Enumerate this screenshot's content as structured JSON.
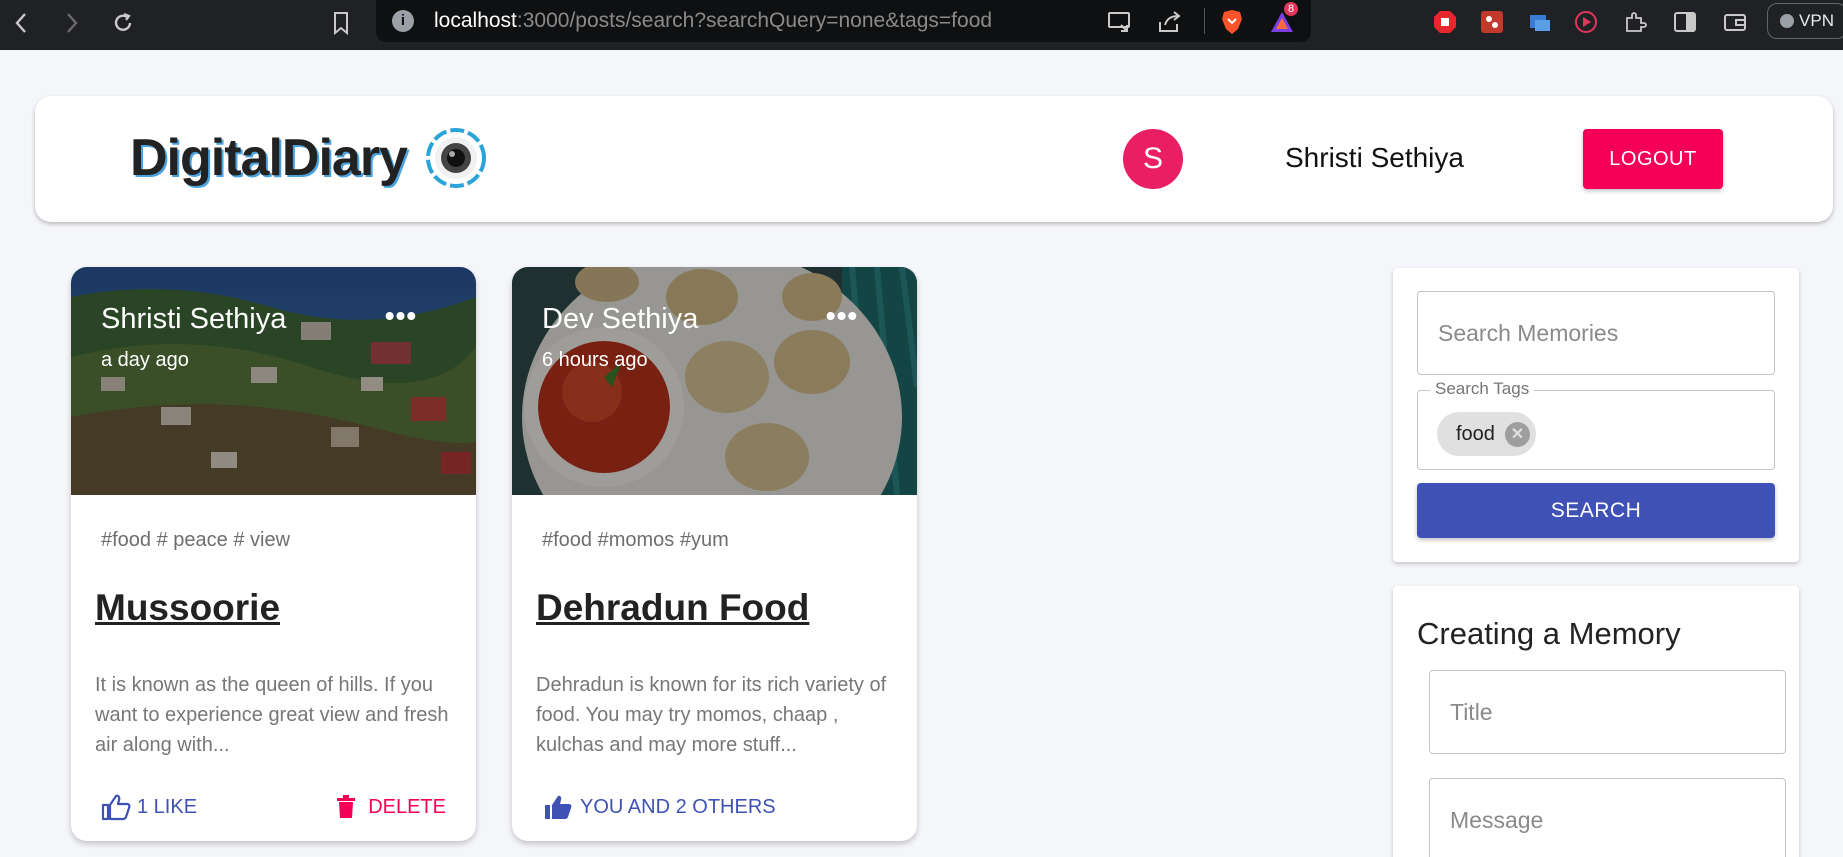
{
  "browser": {
    "url_host": "localhost",
    "url_rest": ":3000/posts/search?searchQuery=none&tags=food",
    "notification_count": "8",
    "vpn_label": "VPN"
  },
  "header": {
    "brand": "DigitalDiary",
    "avatar_initial": "S",
    "username": "Shristi Sethiya",
    "logout_label": "LOGOUT"
  },
  "posts": [
    {
      "author": "Shristi Sethiya",
      "time": "a day ago",
      "tags": "#food # peace # view",
      "title": "Mussoorie",
      "message": "It is known as the queen of hills. If you want to experience great view and fresh air along with...",
      "like_label": "1 LIKE",
      "delete_label": "DELETE"
    },
    {
      "author": "Dev Sethiya",
      "time": "6 hours ago",
      "tags": "#food #momos #yum",
      "title": "Dehradun Food",
      "message": "Dehradun is known for its rich variety of food. You may try momos, chaap , kulchas and may more stuff...",
      "like_label": "YOU AND 2 OTHERS"
    }
  ],
  "search": {
    "placeholder": "Search Memories",
    "tags_label": "Search Tags",
    "tags": [
      "food"
    ],
    "button_label": "SEARCH"
  },
  "create": {
    "heading": "Creating a Memory",
    "title_placeholder": "Title",
    "message_placeholder": "Message"
  },
  "colors": {
    "primary": "#3f51b5",
    "secondary": "#f50057",
    "avatar": "#e91e63",
    "background": "#f5f6fa"
  }
}
